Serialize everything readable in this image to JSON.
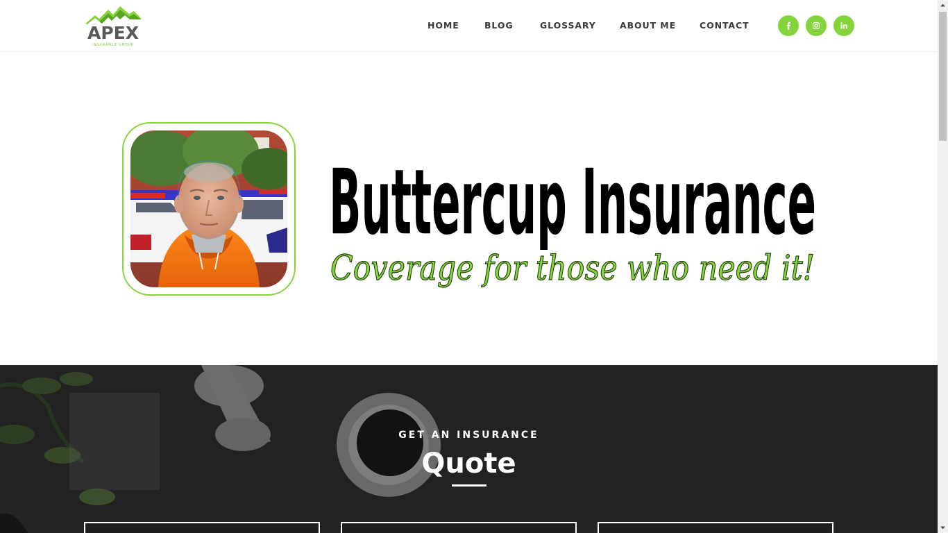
{
  "brand": {
    "logo_word": "APEX",
    "logo_sub": "INSURANCE GROUP",
    "accent_color": "#86d43c",
    "text_color": "#3a3a3a"
  },
  "nav": {
    "items": [
      {
        "label": "HOME"
      },
      {
        "label": "BLOG"
      },
      {
        "label": "GLOSSARY"
      },
      {
        "label": "ABOUT ME"
      },
      {
        "label": "CONTACT"
      }
    ],
    "social": [
      {
        "icon": "facebook-icon"
      },
      {
        "icon": "instagram-icon"
      },
      {
        "icon": "linkedin-icon"
      }
    ]
  },
  "hero": {
    "title": "Buttercup Insurance",
    "tagline": "Coverage for those who need it!",
    "photo_alt": "Portrait of a man in an orange hoodie in front of police cars"
  },
  "quote": {
    "eyebrow": "GET AN INSURANCE",
    "title": "Quote"
  }
}
